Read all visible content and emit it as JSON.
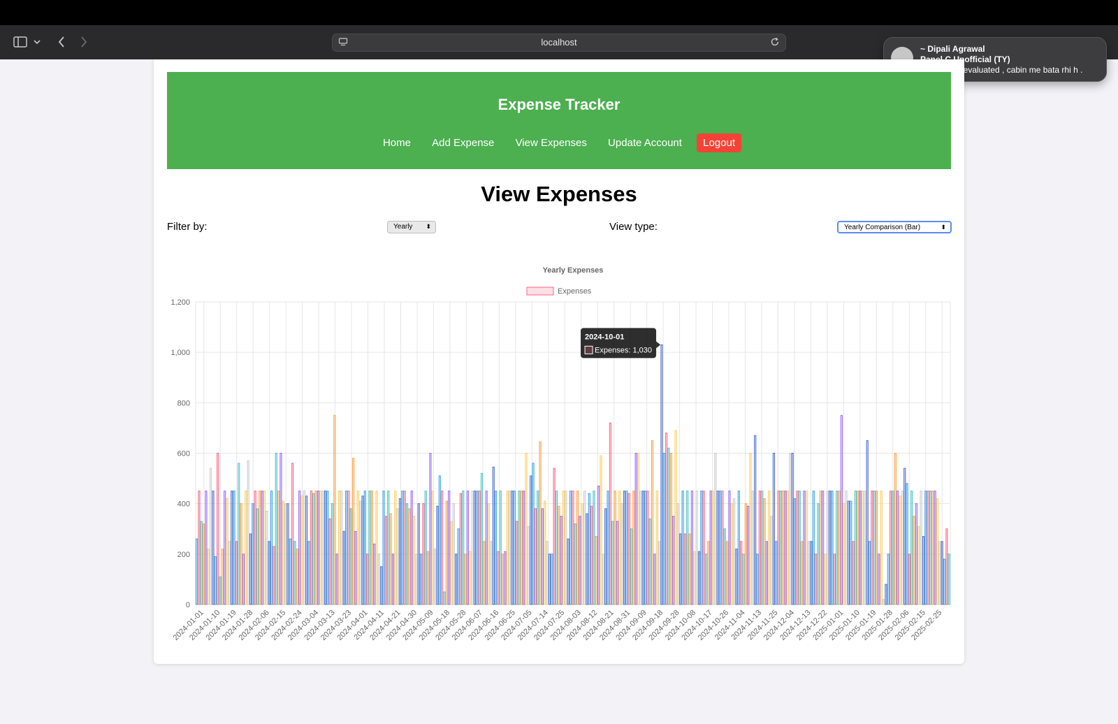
{
  "browser": {
    "url": "localhost"
  },
  "notification": {
    "sender": "~ Dipali Agrawal",
    "group": "Panel C Unofficial (TY)",
    "message": "Ma'am has evaluated , cabin me bata rhi h ."
  },
  "header": {
    "title": "Expense Tracker",
    "nav": {
      "home": "Home",
      "add_expense": "Add Expense",
      "view_expenses": "View Expenses",
      "update_account": "Update Account",
      "logout": "Logout"
    }
  },
  "main": {
    "title": "View Expenses",
    "filter_label": "Filter by:",
    "filter_value": "Yearly",
    "view_type_label": "View type:",
    "view_type_value": "Yearly Comparison (Bar)"
  },
  "colors": {
    "header_green": "#4caf50",
    "logout_red": "#f44336",
    "bar_palette": [
      "#36a2eb",
      "#ff6384",
      "#4bc0c0",
      "#ff9f40",
      "#9966ff",
      "#ffcd56",
      "#c9cbcf",
      "#4a6cd4"
    ]
  },
  "chart_data": {
    "type": "bar",
    "title": "Yearly Expenses",
    "legend": [
      "Expenses"
    ],
    "legend_position": "top",
    "grid": true,
    "ylim": [
      0,
      1200
    ],
    "yticks": [
      0,
      200,
      400,
      600,
      800,
      1000,
      1200
    ],
    "x_tick_labels": [
      "2024-01-01",
      "2024-01-10",
      "2024-01-19",
      "2024-01-28",
      "2024-02-06",
      "2024-02-15",
      "2024-02-24",
      "2024-03-04",
      "2024-03-13",
      "2024-03-23",
      "2024-04-01",
      "2024-04-11",
      "2024-04-21",
      "2024-04-30",
      "2024-05-09",
      "2024-05-18",
      "2024-05-28",
      "2024-06-07",
      "2024-06-16",
      "2024-06-25",
      "2024-07-05",
      "2024-07-14",
      "2024-07-25",
      "2024-08-03",
      "2024-08-12",
      "2024-08-21",
      "2024-08-31",
      "2024-09-09",
      "2024-09-18",
      "2024-09-28",
      "2024-10-08",
      "2024-10-17",
      "2024-10-26",
      "2024-11-04",
      "2024-11-13",
      "2024-11-25",
      "2024-12-04",
      "2024-12-13",
      "2024-12-22",
      "2025-01-01",
      "2025-01-10",
      "2025-01-19",
      "2025-01-28",
      "2025-02-06",
      "2025-02-15",
      "2025-02-25"
    ],
    "tooltip": {
      "date": "2024-10-01",
      "text": "Expenses: 1,030"
    },
    "values": [
      260,
      450,
      330,
      320,
      450,
      220,
      540,
      450,
      190,
      600,
      110,
      220,
      450,
      420,
      250,
      450,
      450,
      250,
      560,
      400,
      200,
      450,
      570,
      280,
      400,
      450,
      380,
      450,
      450,
      450,
      370,
      250,
      450,
      230,
      600,
      450,
      600,
      410,
      400,
      400,
      260,
      560,
      250,
      220,
      450,
      430,
      450,
      430,
      250,
      450,
      440,
      450,
      450,
      450,
      450,
      450,
      450,
      340,
      400,
      750,
      200,
      450,
      450,
      290,
      450,
      450,
      380,
      580,
      290,
      450,
      410,
      430,
      450,
      200,
      450,
      450,
      240,
      450,
      200,
      150,
      450,
      350,
      450,
      360,
      200,
      450,
      380,
      420,
      450,
      450,
      400,
      380,
      450,
      350,
      200,
      400,
      200,
      400,
      450,
      210,
      600,
      450,
      220,
      390,
      510,
      450,
      50,
      410,
      450,
      330,
      400,
      200,
      300,
      440,
      450,
      200,
      450,
      210,
      450,
      450,
      450,
      450,
      520,
      250,
      450,
      400,
      250,
      545,
      450,
      210,
      450,
      200,
      210,
      450,
      450,
      450,
      450,
      330,
      450,
      450,
      450,
      600,
      310,
      510,
      560,
      380,
      450,
      645,
      380,
      410,
      250,
      200,
      200,
      540,
      450,
      390,
      350,
      450,
      450,
      260,
      450,
      450,
      320,
      450,
      350,
      400,
      450,
      360,
      440,
      390,
      450,
      270,
      470,
      590,
      200,
      380,
      450,
      720,
      330,
      450,
      330,
      450,
      400,
      450,
      450,
      440,
      300,
      450,
      600,
      600,
      450,
      450,
      450,
      450,
      340,
      650,
      200,
      450,
      250,
      1030,
      600,
      680,
      620,
      600,
      350,
      690,
      400,
      280,
      450,
      280,
      450,
      280,
      450,
      210,
      450,
      210,
      450,
      450,
      200,
      250,
      450,
      450,
      600,
      450,
      450,
      450,
      300,
      250,
      450,
      400,
      420,
      220,
      450,
      250,
      200,
      400,
      390,
      600,
      450,
      670,
      200,
      450,
      450,
      420,
      250,
      450,
      350,
      600,
      250,
      450,
      450,
      450,
      450,
      450,
      600,
      600,
      420,
      450,
      450,
      250,
      450,
      450,
      250,
      250,
      450,
      200,
      400,
      450,
      450,
      200,
      450,
      450,
      450,
      200,
      450,
      450,
      750,
      400,
      450,
      410,
      410,
      250,
      450,
      450,
      450,
      450,
      450,
      650,
      250,
      450,
      450,
      450,
      200,
      450,
      20,
      80,
      200,
      450,
      450,
      600,
      450,
      430,
      450,
      540,
      480,
      200,
      450,
      350,
      400,
      310,
      450,
      270,
      450,
      450,
      450,
      450,
      450,
      420,
      250,
      250,
      180,
      300,
      200
    ]
  }
}
